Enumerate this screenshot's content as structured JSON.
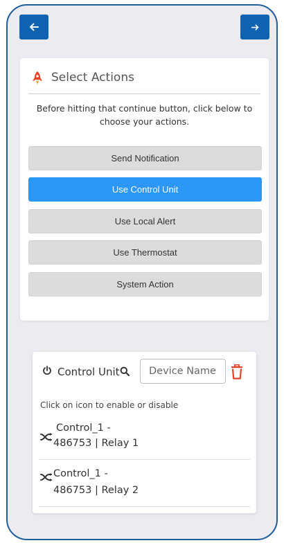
{
  "navigation": {
    "back_icon": "arrow-left-icon",
    "forward_icon": "arrow-right-icon",
    "color": "#0f63b0"
  },
  "select_actions": {
    "title": "Select Actions",
    "icon": "rocket-icon",
    "description": "Before hitting that continue button, click below to choose your actions.",
    "actions": [
      {
        "label": "Send Notification",
        "selected": false
      },
      {
        "label": "Use Control Unit",
        "selected": true
      },
      {
        "label": "Use Local Alert",
        "selected": false
      },
      {
        "label": "Use Thermostat",
        "selected": false
      },
      {
        "label": "System Action",
        "selected": false
      }
    ],
    "active_color": "#2d97f7"
  },
  "control_unit": {
    "title": "Control Unit",
    "power_icon": "power-icon",
    "search_icon": "search-icon",
    "device_name_placeholder": "Device Name",
    "delete_icon": "trash-icon",
    "delete_color": "#e0442b",
    "hint": "Click on icon to enable or disable",
    "devices": [
      {
        "line1": "Control_1 -",
        "line2": "486753 | Relay 1",
        "icon": "shuffle-icon"
      },
      {
        "line1": "Control_1 -",
        "line2": "486753 | Relay 2",
        "icon": "shuffle-icon"
      }
    ]
  }
}
